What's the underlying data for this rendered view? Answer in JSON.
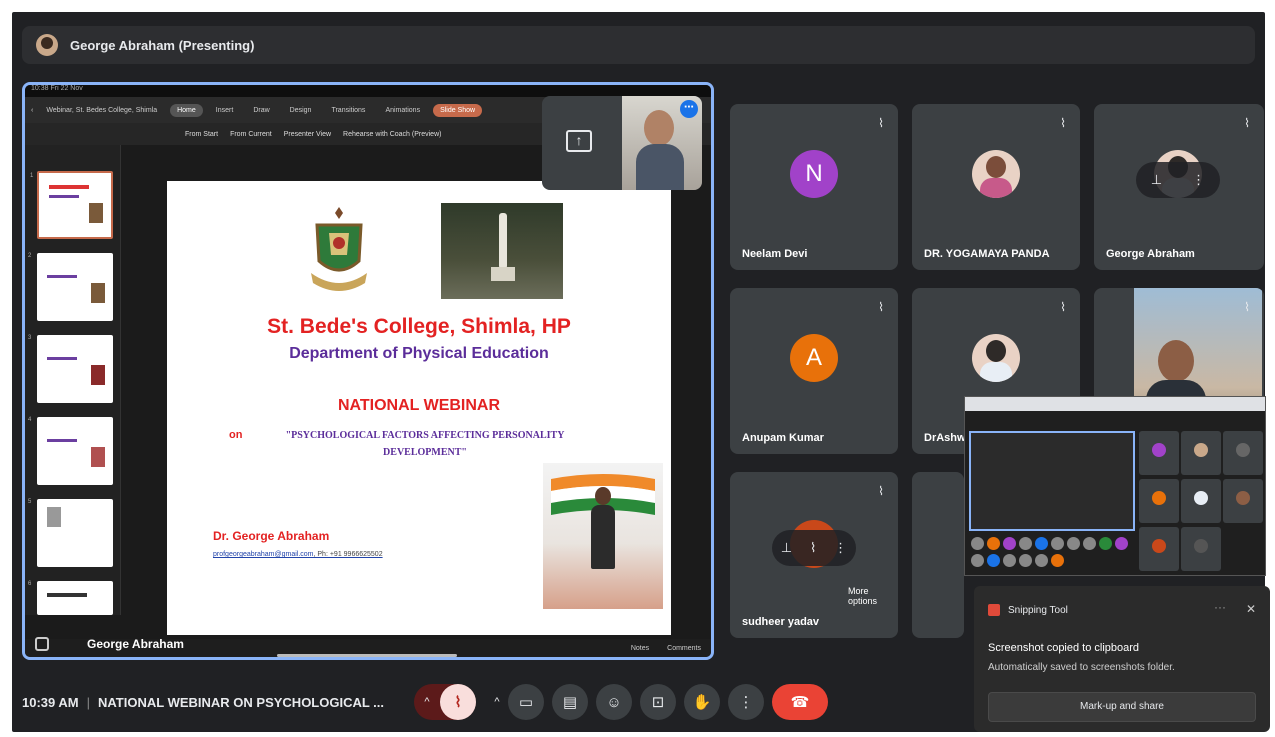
{
  "topbar": {
    "presenter_title": "George Abraham (Presenting)"
  },
  "ppt": {
    "status_left": "10:38  Fri 22 Nov",
    "tabs": [
      "Webinar, St. Bedes College, Shimla",
      "Home",
      "Insert",
      "Draw",
      "Design",
      "Transitions",
      "Animations",
      "Slide Show"
    ],
    "toolbar": [
      "From Start",
      "From Current",
      "Presenter View",
      "Rehearse with Coach (Preview)"
    ],
    "bottom": [
      "Notes",
      "Comments"
    ],
    "thumb_numbers": [
      "1",
      "2",
      "3",
      "4",
      "5",
      "6"
    ]
  },
  "slide": {
    "college": "St. Bede's College, Shimla, HP",
    "department": "Department of Physical Education",
    "event": "NATIONAL WEBINAR",
    "on": "on",
    "topic": "\"PSYCHOLOGICAL FACTORS AFFECTING PERSONALITY DEVELOPMENT\"",
    "author": "Dr. George Abraham",
    "email": "profgeorgeabraham@gmail.com",
    "phone": ", Ph: +91 9966625502"
  },
  "stage_name": "George Abraham",
  "pip": {
    "label": "George Abraham",
    "more": "⋯"
  },
  "participants": [
    {
      "name": "Neelam Devi",
      "initial": "N",
      "color": "#a142c9"
    },
    {
      "name": "DR. YOGAMAYA PANDA"
    },
    {
      "name": "George Abraham"
    },
    {
      "name": "Anupam Kumar",
      "initial": "A",
      "color": "#e8710a"
    },
    {
      "name": "DrAshw"
    },
    {
      "name": ""
    },
    {
      "name": "sudheer yadav"
    }
  ],
  "more_options": "More options",
  "toast": {
    "app": "Snipping Tool",
    "title": "Screenshot copied to clipboard",
    "subtitle": "Automatically saved to screenshots folder.",
    "action": "Mark-up and share",
    "close": "✕",
    "dots": "···"
  },
  "bottom": {
    "time": "10:39 AM",
    "separator": "|",
    "meeting": "NATIONAL WEBINAR ON PSYCHOLOGICAL ..."
  },
  "colors": {
    "accent": "#8ab4f8",
    "end_call": "#ea4335",
    "mic_muted": "#f9dedc"
  }
}
